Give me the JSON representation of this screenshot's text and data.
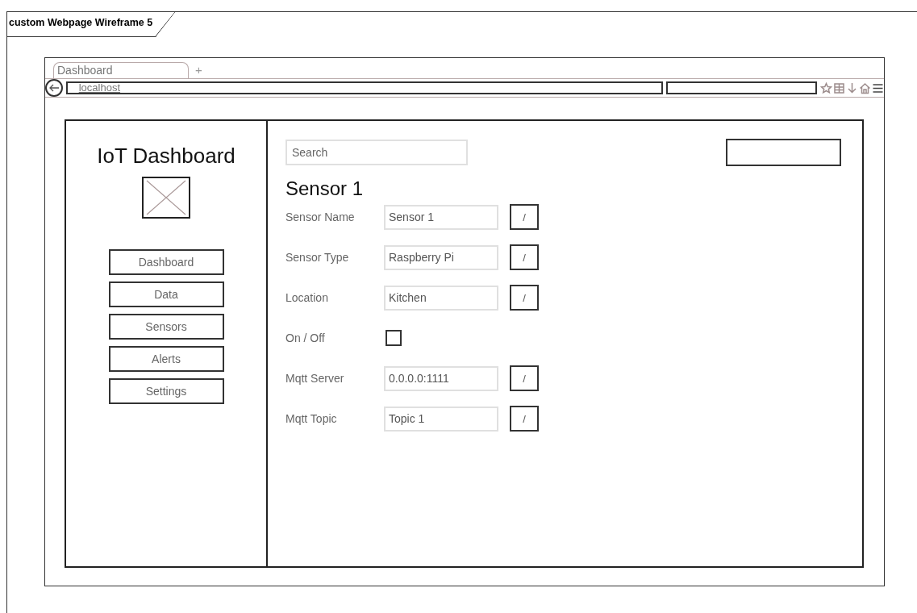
{
  "frame": {
    "title": "custom Webpage Wireframe 5"
  },
  "browser": {
    "tabs": [
      {
        "label": "Dashboard",
        "selected": true
      }
    ],
    "new_tab": "+",
    "url": "localhost"
  },
  "sidebar": {
    "title": "IoT Dashboard",
    "nav": [
      {
        "label": "Dashboard"
      },
      {
        "label": "Data"
      },
      {
        "label": "Sensors"
      },
      {
        "label": "Alerts"
      },
      {
        "label": "Settings"
      }
    ]
  },
  "main": {
    "search": {
      "placeholder": "Search"
    },
    "heading": "Sensor 1",
    "fields": [
      {
        "kind": "text",
        "label": "Sensor Name",
        "value": "Sensor 1",
        "edit": "/"
      },
      {
        "kind": "text",
        "label": "Sensor Type",
        "value": "Raspberry Pi",
        "edit": "/"
      },
      {
        "kind": "text",
        "label": "Location",
        "value": "Kitchen",
        "edit": "/"
      },
      {
        "kind": "checkbox",
        "label": "On / Off",
        "checked": false
      },
      {
        "kind": "text",
        "label": "Mqtt Server",
        "value": "0.0.0.0:1111",
        "edit": "/"
      },
      {
        "kind": "text",
        "label": "Mqtt Topic",
        "value": "Topic 1",
        "edit": "/"
      }
    ]
  }
}
